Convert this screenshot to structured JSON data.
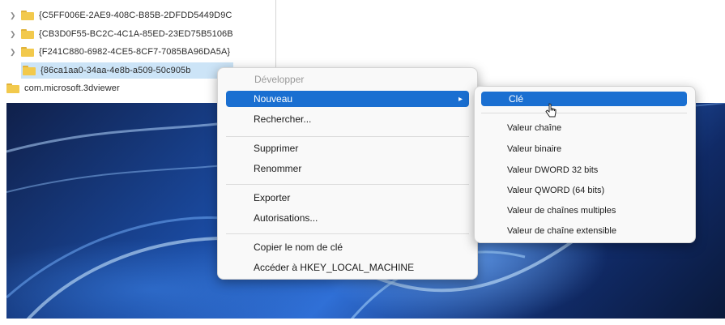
{
  "tree": {
    "items": [
      {
        "label": "{C5FF006E-2AE9-408C-B85B-2DFDD5449D9C"
      },
      {
        "label": "{CB3D0F55-BC2C-4C1A-85ED-23ED75B5106B"
      },
      {
        "label": "{F241C880-6982-4CE5-8CF7-7085BA96DA5A}"
      },
      {
        "label": "{86ca1aa0-34aa-4e8b-a509-50c905b"
      },
      {
        "label": "com.microsoft.3dviewer"
      }
    ]
  },
  "context_menu": {
    "expand": "Développer",
    "new": "Nouveau",
    "find": "Rechercher...",
    "delete": "Supprimer",
    "rename": "Renommer",
    "export": "Exporter",
    "permissions": "Autorisations...",
    "copy_key_name": "Copier le nom de clé",
    "goto_hklm": "Accéder à HKEY_LOCAL_MACHINE"
  },
  "submenu": {
    "key": "Clé",
    "string_value": "Valeur chaîne",
    "binary_value": "Valeur binaire",
    "dword_value": "Valeur DWORD 32 bits",
    "qword_value": "Valeur QWORD (64 bits)",
    "multi_string_value": "Valeur de chaînes multiples",
    "expandable_string_value": "Valeur de chaîne extensible"
  }
}
